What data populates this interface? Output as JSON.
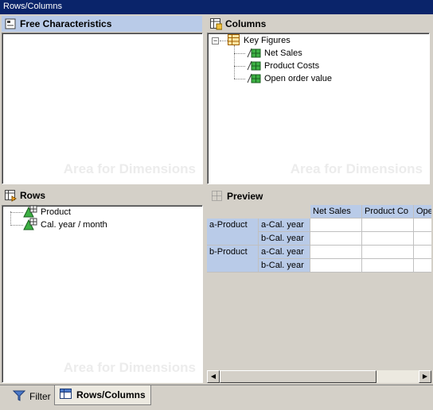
{
  "window": {
    "title": "Rows/Columns"
  },
  "free_characteristics": {
    "title": "Free Characteristics",
    "watermark": "Area for Dimensions"
  },
  "columns_panel": {
    "title": "Columns",
    "watermark": "Area for Dimensions",
    "tree": {
      "root": "Key Figures",
      "items": [
        "Net Sales",
        "Product Costs",
        "Open order value"
      ]
    }
  },
  "rows_panel": {
    "title": "Rows",
    "watermark": "Area for Dimensions",
    "items": [
      "Product",
      "Cal. year / month"
    ]
  },
  "preview": {
    "title": "Preview",
    "column_headers": [
      "Net Sales",
      "Product Co",
      "Ope"
    ],
    "row_groups": [
      {
        "label": "a-Product",
        "subrows": [
          "a-Cal. year",
          "b-Cal. year"
        ]
      },
      {
        "label": "b-Product",
        "subrows": [
          "a-Cal. year",
          "b-Cal. year"
        ]
      }
    ]
  },
  "tabs": [
    {
      "label": "Filter",
      "icon": "filter-icon",
      "active": false
    },
    {
      "label": "Rows/Columns",
      "icon": "table-icon",
      "active": true
    }
  ],
  "colors": {
    "header_blue": "#b9cbe8",
    "title_bar": "#0a246a",
    "background": "#d4d0c8"
  }
}
